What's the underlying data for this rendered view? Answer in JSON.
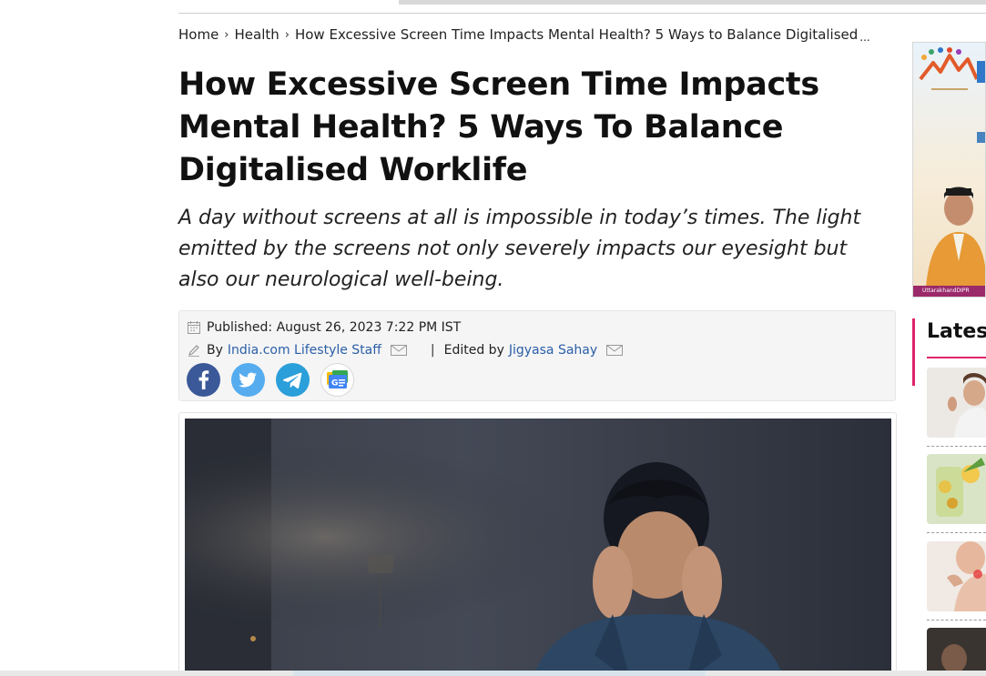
{
  "breadcrumb": {
    "home": "Home",
    "section": "Health",
    "current": "How Excessive Screen Time Impacts Mental Health? 5 Ways to Balance Digitalised",
    "ellipsis": "..."
  },
  "article": {
    "headline": "How Excessive Screen Time Impacts Mental Health? 5 Ways To Balance Digitalised Worklife",
    "subhead": "A day without screens at all is impossible in today’s times. The light emitted by the screens not only severely impacts our eyesight but also our neurological well-being."
  },
  "meta": {
    "published": "Published: August 26, 2023 7:22 PM IST",
    "by_prefix": "By",
    "author": "India.com Lifestyle Staff",
    "pipe": "|",
    "edited_prefix": "Edited by",
    "editor": "Jigyasa Sahay"
  },
  "share": [
    {
      "name": "facebook-icon",
      "color": "#3b5998"
    },
    {
      "name": "twitter-icon",
      "color": "#55acee"
    },
    {
      "name": "telegram-icon",
      "color": "#2b9fd9"
    },
    {
      "name": "google-news-icon",
      "color": "#ffffff"
    }
  ],
  "sidebar": {
    "latest_title": "Latest",
    "ad_footer": "UttarakhandDIPR"
  }
}
